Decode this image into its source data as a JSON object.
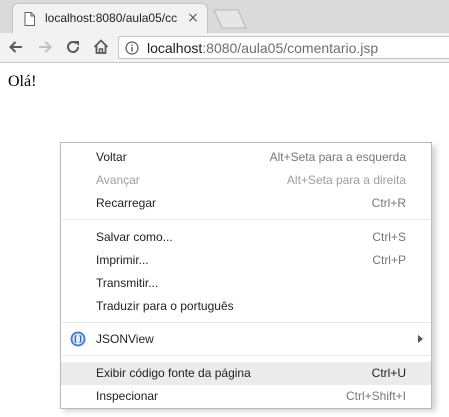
{
  "browser": {
    "tab": {
      "title": "localhost:8080/aula05/cc",
      "close": "×"
    },
    "toolbar": {
      "url_host": "localhost",
      "url_path": ":8080/aula05/comentario.jsp"
    }
  },
  "page": {
    "text": "Olá!"
  },
  "context_menu": {
    "items": [
      {
        "label": "Voltar",
        "shortcut": "Alt+Seta para a esquerda",
        "enabled": true
      },
      {
        "label": "Avançar",
        "shortcut": "Alt+Seta para a direita",
        "enabled": false
      },
      {
        "label": "Recarregar",
        "shortcut": "Ctrl+R",
        "enabled": true
      },
      {
        "label": "Salvar como...",
        "shortcut": "Ctrl+S",
        "enabled": true
      },
      {
        "label": "Imprimir...",
        "shortcut": "Ctrl+P",
        "enabled": true
      },
      {
        "label": "Transmitir...",
        "shortcut": "",
        "enabled": true
      },
      {
        "label": "Traduzir para o português",
        "shortcut": "",
        "enabled": true
      },
      {
        "label": "JSONView",
        "shortcut": "",
        "enabled": true,
        "icon": "jsonview-icon",
        "submenu": true
      },
      {
        "label": "Exibir código fonte da página",
        "shortcut": "Ctrl+U",
        "enabled": true,
        "highlighted": true
      },
      {
        "label": "Inspecionar",
        "shortcut": "Ctrl+Shift+I",
        "enabled": true
      }
    ]
  },
  "icons": {
    "tab_favicon": "page-icon",
    "back": "back-arrow-icon",
    "forward": "forward-arrow-icon",
    "reload": "reload-icon",
    "home": "home-icon",
    "site_info": "info-icon"
  },
  "colors": {
    "menu_highlight": "#ebebeb",
    "disabled_text": "#9e9e9e"
  }
}
